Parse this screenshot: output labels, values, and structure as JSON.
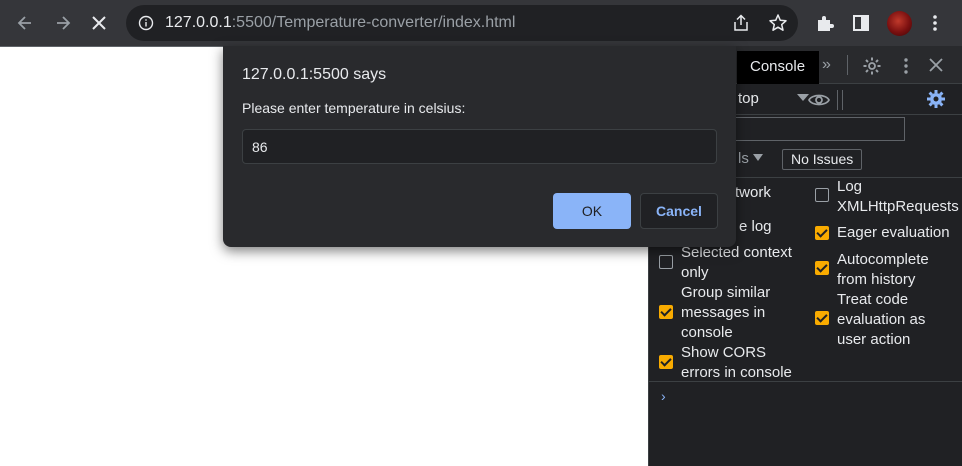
{
  "browser": {
    "url_host": "127.0.0.1",
    "url_path": ":5500/Temperature-converter/index.html",
    "icons": {
      "back": "arrow-left-icon",
      "forward": "arrow-right-icon",
      "stop": "close-icon",
      "info": "info-icon",
      "share": "share-icon",
      "bookmark": "star-icon",
      "extensions": "puzzle-icon",
      "side_panel": "side-panel-icon",
      "menu": "kebab-icon"
    }
  },
  "dialog": {
    "title": "127.0.0.1:5500 says",
    "message": "Please enter temperature in celsius:",
    "input_value": "86",
    "ok_label": "OK",
    "cancel_label": "Cancel"
  },
  "devtools": {
    "tab_console": "Console",
    "more_tabs": "»",
    "context": "top",
    "levels_partial": "ls",
    "issues_label": "No Issues",
    "options_left": [
      {
        "label": "twork",
        "checked": null
      },
      {
        "label": "e log",
        "checked": null
      },
      {
        "label": "Selected context only",
        "checked": false
      },
      {
        "label": "Group similar messages in console",
        "checked": true
      },
      {
        "label": "Show CORS errors in console",
        "checked": true
      }
    ],
    "options_right": [
      {
        "label": "Log XMLHttpRequests",
        "checked": false
      },
      {
        "label": "Eager evaluation",
        "checked": true
      },
      {
        "label": "Autocomplete from history",
        "checked": true
      },
      {
        "label": "Treat code evaluation as user action",
        "checked": true
      }
    ],
    "prompt_symbol": "›",
    "accent_color": "#f9ab00",
    "link_color": "#8ab4f8"
  }
}
